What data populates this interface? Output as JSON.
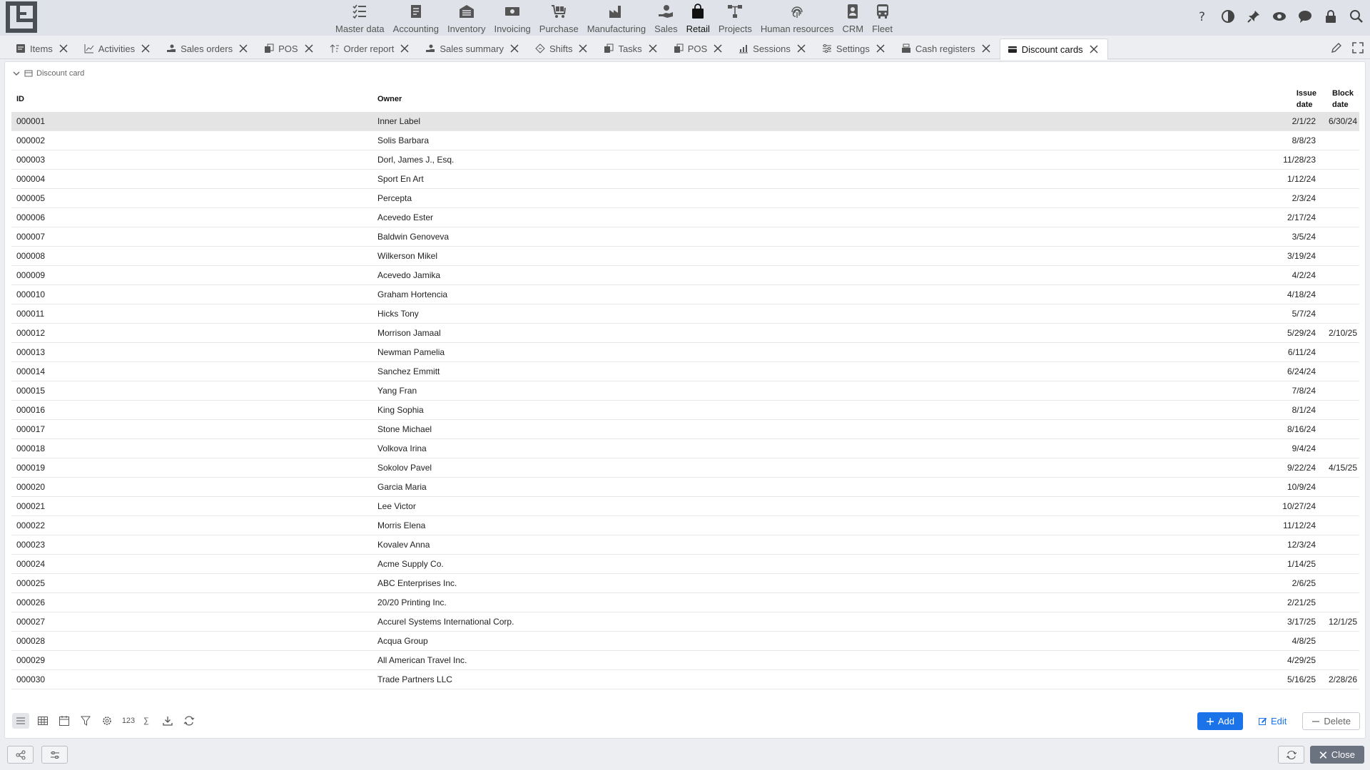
{
  "modules": [
    {
      "label": "Master data",
      "icon": "list-icon"
    },
    {
      "label": "Accounting",
      "icon": "ledger-icon"
    },
    {
      "label": "Inventory",
      "icon": "warehouse-icon"
    },
    {
      "label": "Invoicing",
      "icon": "cash-icon"
    },
    {
      "label": "Purchase",
      "icon": "cart-icon"
    },
    {
      "label": "Manufacturing",
      "icon": "factory-icon"
    },
    {
      "label": "Sales",
      "icon": "hand-coin-icon"
    },
    {
      "label": "Retail",
      "icon": "bag-icon"
    },
    {
      "label": "Projects",
      "icon": "hierarchy-icon"
    },
    {
      "label": "Human resources",
      "icon": "fingerprint-icon"
    },
    {
      "label": "CRM",
      "icon": "contact-icon"
    },
    {
      "label": "Fleet",
      "icon": "bus-icon"
    }
  ],
  "active_module": "Retail",
  "tabs": [
    {
      "label": "Items"
    },
    {
      "label": "Activities"
    },
    {
      "label": "Sales orders"
    },
    {
      "label": "POS"
    },
    {
      "label": "Order report"
    },
    {
      "label": "Sales summary"
    },
    {
      "label": "Shifts"
    },
    {
      "label": "Tasks"
    },
    {
      "label": "POS"
    },
    {
      "label": "Sessions"
    },
    {
      "label": "Settings"
    },
    {
      "label": "Cash registers"
    },
    {
      "label": "Discount cards"
    }
  ],
  "active_tab": "Discount cards",
  "panel": {
    "title": "Discount card"
  },
  "table": {
    "headers": {
      "id": "ID",
      "owner": "Owner",
      "issue_line1": "Issue",
      "issue_line2": "date",
      "block_line1": "Block",
      "block_line2": "date"
    },
    "rows": [
      {
        "id": "000001",
        "owner": "Inner Label",
        "issue": "2/1/22",
        "block": "6/30/24"
      },
      {
        "id": "000002",
        "owner": "Solis Barbara",
        "issue": "8/8/23",
        "block": ""
      },
      {
        "id": "000003",
        "owner": "Dorl, James J., Esq.",
        "issue": "11/28/23",
        "block": ""
      },
      {
        "id": "000004",
        "owner": "Sport En Art",
        "issue": "1/12/24",
        "block": ""
      },
      {
        "id": "000005",
        "owner": "Percepta",
        "issue": "2/3/24",
        "block": ""
      },
      {
        "id": "000006",
        "owner": "Acevedo Ester",
        "issue": "2/17/24",
        "block": ""
      },
      {
        "id": "000007",
        "owner": "Baldwin Genoveva",
        "issue": "3/5/24",
        "block": ""
      },
      {
        "id": "000008",
        "owner": "Wilkerson Mikel",
        "issue": "3/19/24",
        "block": ""
      },
      {
        "id": "000009",
        "owner": "Acevedo Jamika",
        "issue": "4/2/24",
        "block": ""
      },
      {
        "id": "000010",
        "owner": "Graham Hortencia",
        "issue": "4/18/24",
        "block": ""
      },
      {
        "id": "000011",
        "owner": "Hicks Tony",
        "issue": "5/7/24",
        "block": ""
      },
      {
        "id": "000012",
        "owner": "Morrison Jamaal",
        "issue": "5/29/24",
        "block": "2/10/25"
      },
      {
        "id": "000013",
        "owner": "Newman Pamelia",
        "issue": "6/11/24",
        "block": ""
      },
      {
        "id": "000014",
        "owner": "Sanchez Emmitt",
        "issue": "6/24/24",
        "block": ""
      },
      {
        "id": "000015",
        "owner": "Yang Fran",
        "issue": "7/8/24",
        "block": ""
      },
      {
        "id": "000016",
        "owner": "King Sophia",
        "issue": "8/1/24",
        "block": ""
      },
      {
        "id": "000017",
        "owner": "Stone Michael",
        "issue": "8/16/24",
        "block": ""
      },
      {
        "id": "000018",
        "owner": "Volkova Irina",
        "issue": "9/4/24",
        "block": ""
      },
      {
        "id": "000019",
        "owner": "Sokolov Pavel",
        "issue": "9/22/24",
        "block": "4/15/25"
      },
      {
        "id": "000020",
        "owner": "Garcia Maria",
        "issue": "10/9/24",
        "block": ""
      },
      {
        "id": "000021",
        "owner": "Lee Victor",
        "issue": "10/27/24",
        "block": ""
      },
      {
        "id": "000022",
        "owner": "Morris Elena",
        "issue": "11/12/24",
        "block": ""
      },
      {
        "id": "000023",
        "owner": "Kovalev Anna",
        "issue": "12/3/24",
        "block": ""
      },
      {
        "id": "000024",
        "owner": "Acme Supply Co.",
        "issue": "1/14/25",
        "block": ""
      },
      {
        "id": "000025",
        "owner": "ABC Enterprises Inc.",
        "issue": "2/6/25",
        "block": ""
      },
      {
        "id": "000026",
        "owner": "20/20 Printing Inc.",
        "issue": "2/21/25",
        "block": ""
      },
      {
        "id": "000027",
        "owner": "Accurel Systems International Corp.",
        "issue": "3/17/25",
        "block": "12/1/25"
      },
      {
        "id": "000028",
        "owner": "Acqua Group",
        "issue": "4/8/25",
        "block": ""
      },
      {
        "id": "000029",
        "owner": "All American Travel Inc.",
        "issue": "4/29/25",
        "block": ""
      },
      {
        "id": "000030",
        "owner": "Trade Partners LLC",
        "issue": "5/16/25",
        "block": "2/28/26"
      }
    ]
  },
  "toolbar": {
    "counter_label": "123",
    "sum_label": "∑"
  },
  "buttons": {
    "add": "Add",
    "edit": "Edit",
    "delete": "Delete",
    "close": "Close"
  },
  "colors": {
    "primary": "#1a73e8",
    "selected_row": "#e4e4e4",
    "topbar": "#dfe2e8"
  }
}
